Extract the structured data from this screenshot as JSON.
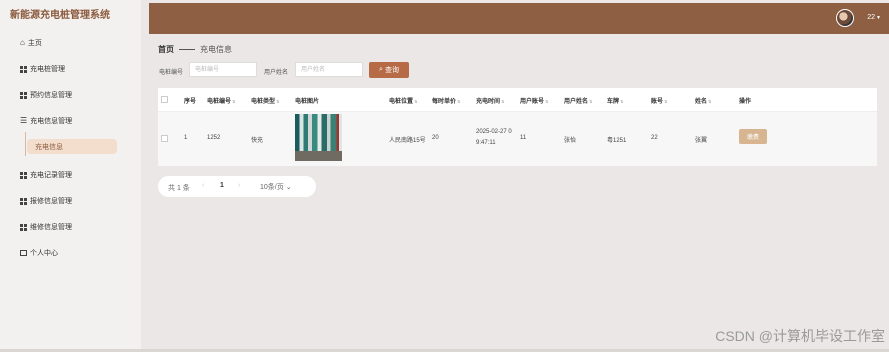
{
  "app": {
    "title": "新能源充电桩管理系统"
  },
  "sidebar": {
    "items": [
      {
        "label": "主页",
        "icon": "home-icon"
      },
      {
        "label": "充电桩管理",
        "icon": "grid-icon"
      },
      {
        "label": "预约信息管理",
        "icon": "grid-icon"
      },
      {
        "label": "充电信息管理",
        "icon": "list-icon"
      },
      {
        "label": "充电信息",
        "icon": "",
        "active": true
      },
      {
        "label": "充电记录管理",
        "icon": "grid-icon"
      },
      {
        "label": "报修信息管理",
        "icon": "grid-icon"
      },
      {
        "label": "维修信息管理",
        "icon": "grid-icon"
      },
      {
        "label": "个人中心",
        "icon": "profile-icon"
      }
    ]
  },
  "header": {
    "user_name": "22",
    "accent": "#8e5f42"
  },
  "breadcrumb": {
    "home": "首页",
    "current": "充电信息"
  },
  "search": {
    "fields": [
      {
        "label": "电桩编号",
        "placeholder": "电桩编号"
      },
      {
        "label": "用户姓名",
        "placeholder": "用户姓名"
      }
    ],
    "button_label": "查询",
    "button_color": "#b66a45"
  },
  "table": {
    "columns": [
      "序号",
      "电桩编号",
      "电桩类型",
      "电桩图片",
      "电桩位置",
      "每时单价",
      "充电时间",
      "用户账号",
      "用户姓名",
      "车牌",
      "账号",
      "姓名",
      "操作"
    ],
    "rows": [
      {
        "index": "1",
        "pile_no": "1252",
        "pile_type": "快充",
        "location": "人民南路15号",
        "price": "20",
        "time_line1": "2025-02-27 0",
        "time_line2": "9:47:11",
        "user_account": "11",
        "user_name": "张怡",
        "plate": "粤1251",
        "account": "22",
        "name": "张翼",
        "action": "缴费"
      }
    ]
  },
  "pagination": {
    "total": "共 1 条",
    "prev": "‹",
    "page": "1",
    "next": "›",
    "page_size": "10条/页",
    "caret": "⌄"
  },
  "watermark": "CSDN @计算机毕设工作室"
}
